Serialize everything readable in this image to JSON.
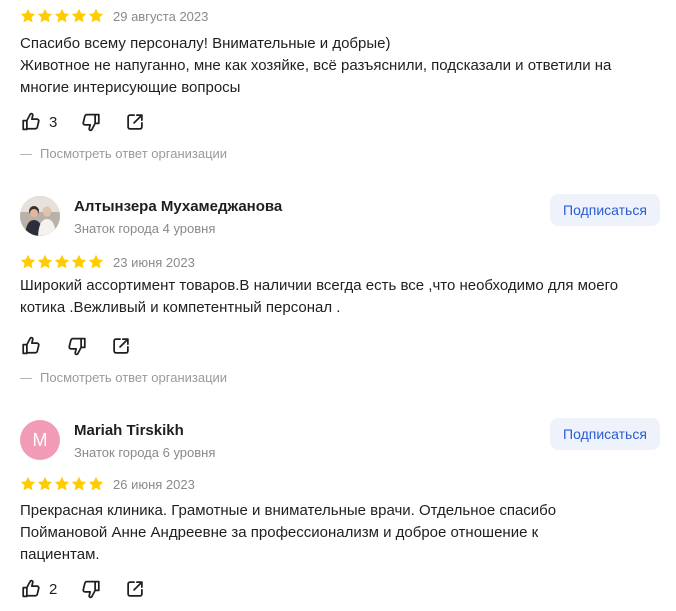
{
  "colors": {
    "star": "#fc0",
    "text": "#1f1f1f",
    "muted": "#8a8a8a",
    "subscribe_bg": "#eef3fb",
    "subscribe_text": "#2a5bd7"
  },
  "reviews": [
    {
      "rating": 5,
      "date": "29 августа 2023",
      "text": [
        "Спасибо всему персоналу! Внимательные и добрые)",
        "Животное не напуганно, мне как хозяйке, всё разъяснили, подсказали и ответили на многие интерисующие вопросы"
      ],
      "likes": "3",
      "org_reply_label": "Посмотреть ответ организации"
    },
    {
      "author": {
        "name": "Алтынзера Мухамеджанова",
        "level": "Знаток города 4 уровня",
        "avatar": "photo"
      },
      "subscribe_label": "Подписаться",
      "rating": 5,
      "date": "23 июня 2023",
      "text": [
        "Широкий ассортимент товаров.В наличии всегда есть все ,что необходимо для моего котика .Вежливый и компетентный персонал ."
      ],
      "likes": "",
      "org_reply_label": "Посмотреть ответ организации"
    },
    {
      "author": {
        "name": "Mariah Tirskikh",
        "level": "Знаток города 6 уровня",
        "avatar_letter": "M"
      },
      "subscribe_label": "Подписаться",
      "rating": 5,
      "date": "26 июня 2023",
      "text": [
        "Прекрасная клиника. Грамотные и внимательные врачи. Отдельное спасибо Поймановой Анне Андреевне за профессионализм и доброе отношение к пациентам."
      ],
      "likes": "2"
    }
  ],
  "icons": {
    "star": "star-icon",
    "like": "thumbs-up-icon",
    "dislike": "thumbs-down-icon",
    "share": "share-icon"
  }
}
